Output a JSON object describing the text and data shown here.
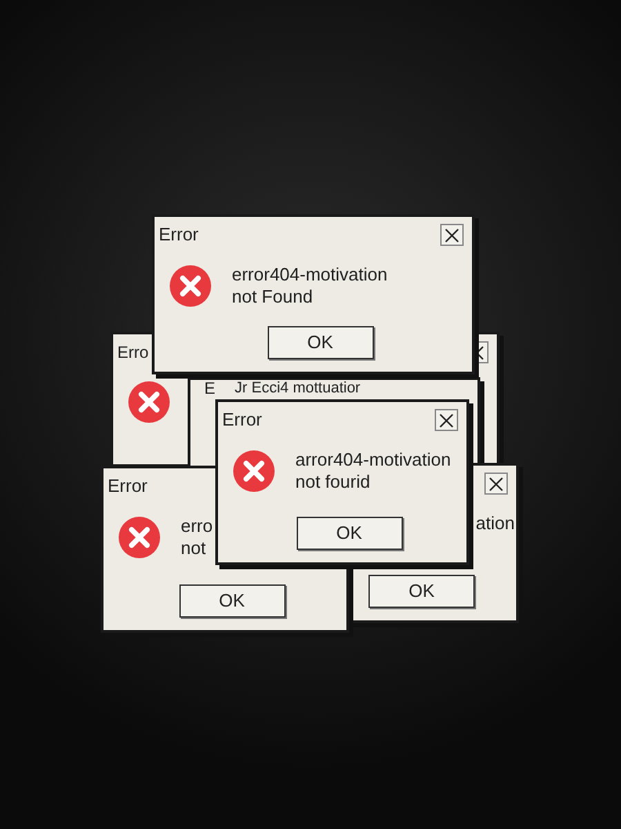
{
  "windows": [
    {
      "title": "Erro",
      "close": true,
      "icon": true
    },
    {
      "title": "E",
      "message": [
        "Jr Ecci4 mottuatior"
      ]
    },
    {
      "close": true,
      "message": [
        "ation"
      ],
      "button": "OK"
    },
    {
      "title": "Error",
      "icon": true,
      "message": [
        "erro",
        "not"
      ],
      "button": "OK"
    },
    {
      "title": "Error",
      "close": true,
      "icon": true,
      "message": [
        "arror404-motivation",
        "not fourid"
      ],
      "button": "OK"
    },
    {
      "title": "Error",
      "close": true,
      "icon": true,
      "message": [
        "error404-motivation",
        "not Found"
      ],
      "button": "OK"
    }
  ]
}
